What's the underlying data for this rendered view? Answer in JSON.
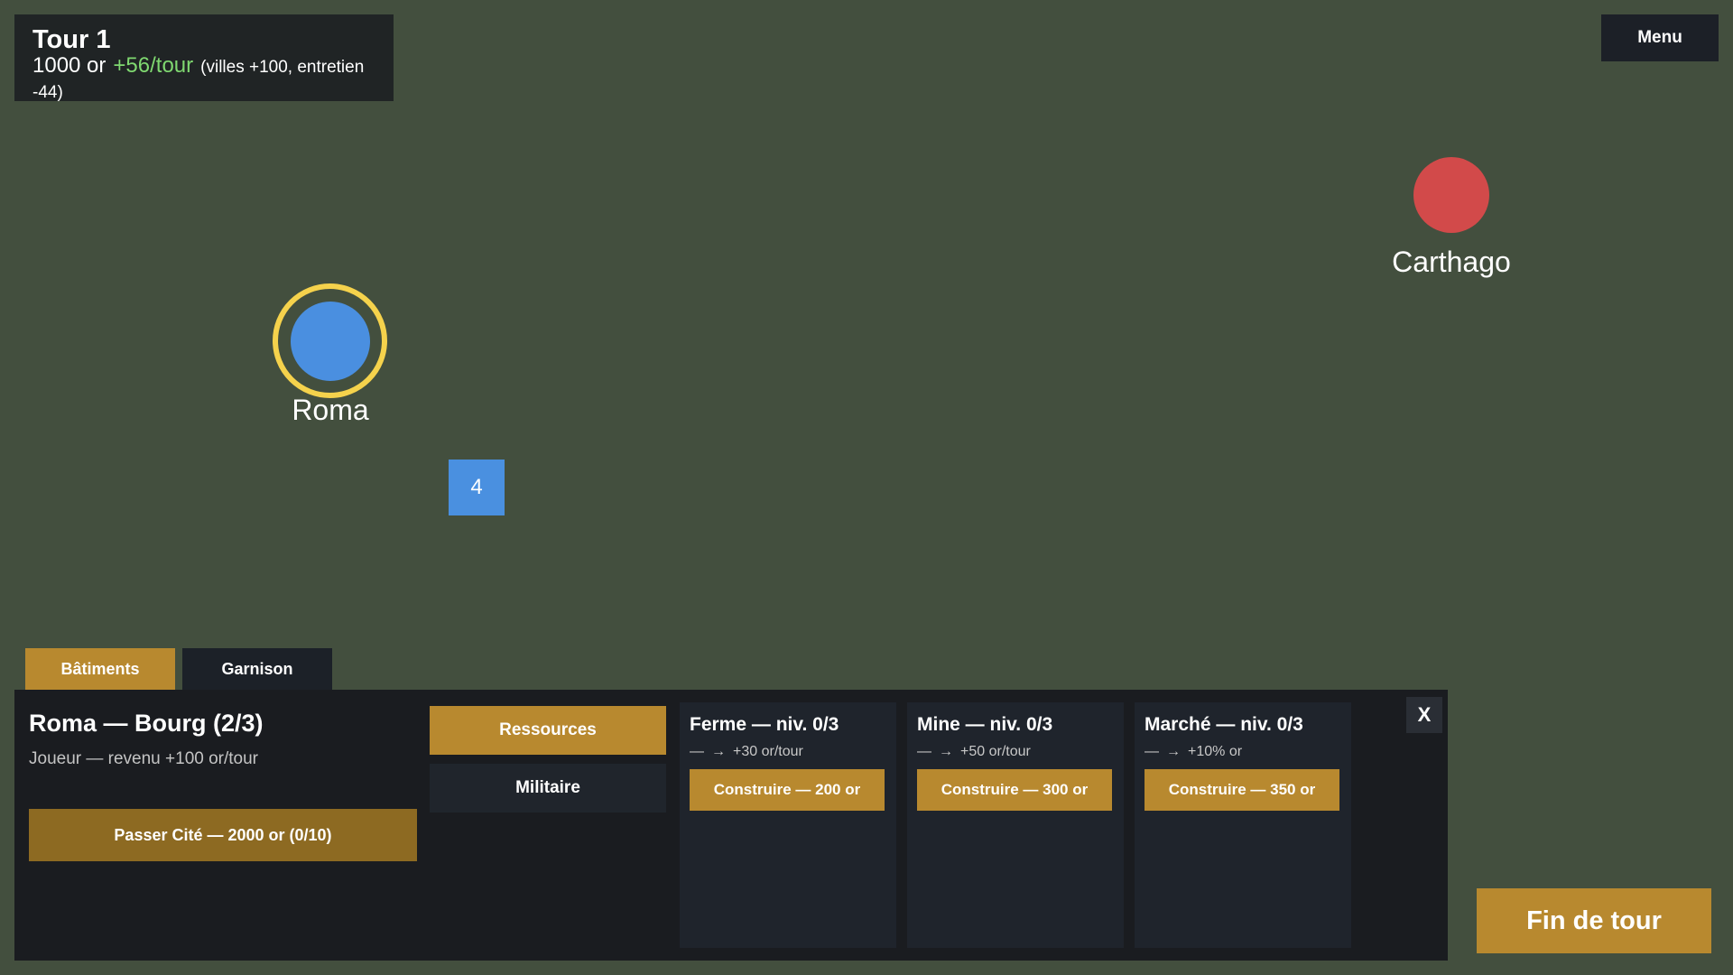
{
  "hud": {
    "turn": "Tour 1",
    "gold": "1000 or",
    "income": "+56/tour",
    "detail": "(villes +100, entretien -44)"
  },
  "menu_label": "Menu",
  "map": {
    "cities": {
      "roma": "Roma",
      "carthago": "Carthago"
    },
    "unit_count": "4",
    "colors": {
      "player": "#4a8fe0",
      "enemy": "#d24a4a",
      "selection": "#f5d24c"
    }
  },
  "tabs": {
    "batiments": "Bâtiments",
    "garnison": "Garnison"
  },
  "panel": {
    "title": "Roma — Bourg (2/3)",
    "subtitle": "Joueur — revenu +100 or/tour",
    "upgrade": "Passer Cité — 2000 or (0/10)",
    "categories": {
      "ressources": "Ressources",
      "militaire": "Militaire"
    },
    "buildings": [
      {
        "title": "Ferme — niv. 0/3",
        "from": "—",
        "arrow": "→",
        "to": "+30 or/tour",
        "build": "Construire — 200 or"
      },
      {
        "title": "Mine — niv. 0/3",
        "from": "—",
        "arrow": "→",
        "to": "+50 or/tour",
        "build": "Construire — 300 or"
      },
      {
        "title": "Marché — niv. 0/3",
        "from": "—",
        "arrow": "→",
        "to": "+10% or",
        "build": "Construire — 350 or"
      }
    ],
    "close": "X"
  },
  "end_turn": "Fin de tour"
}
